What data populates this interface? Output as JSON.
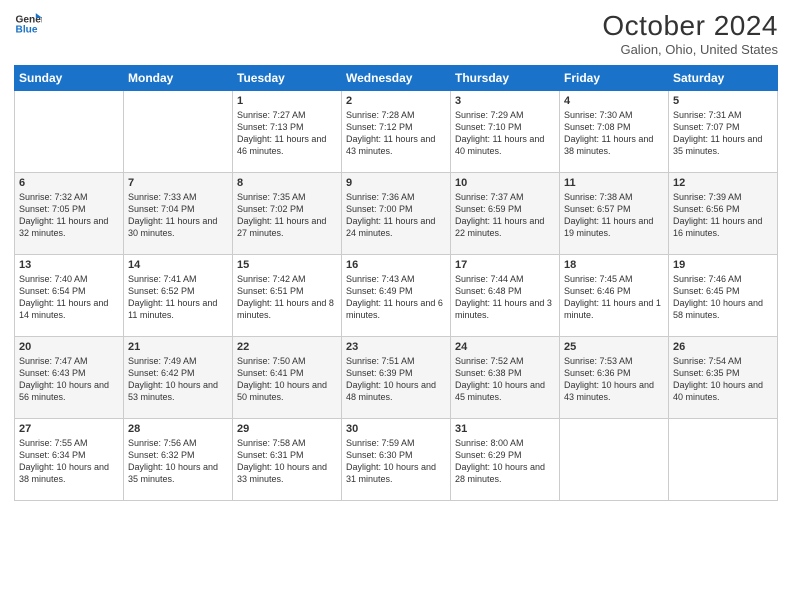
{
  "header": {
    "logo_general": "General",
    "logo_blue": "Blue",
    "month_title": "October 2024",
    "location": "Galion, Ohio, United States"
  },
  "days_of_week": [
    "Sunday",
    "Monday",
    "Tuesday",
    "Wednesday",
    "Thursday",
    "Friday",
    "Saturday"
  ],
  "weeks": [
    [
      {
        "day": "",
        "sunrise": "",
        "sunset": "",
        "daylight": ""
      },
      {
        "day": "",
        "sunrise": "",
        "sunset": "",
        "daylight": ""
      },
      {
        "day": "1",
        "sunrise": "Sunrise: 7:27 AM",
        "sunset": "Sunset: 7:13 PM",
        "daylight": "Daylight: 11 hours and 46 minutes."
      },
      {
        "day": "2",
        "sunrise": "Sunrise: 7:28 AM",
        "sunset": "Sunset: 7:12 PM",
        "daylight": "Daylight: 11 hours and 43 minutes."
      },
      {
        "day": "3",
        "sunrise": "Sunrise: 7:29 AM",
        "sunset": "Sunset: 7:10 PM",
        "daylight": "Daylight: 11 hours and 40 minutes."
      },
      {
        "day": "4",
        "sunrise": "Sunrise: 7:30 AM",
        "sunset": "Sunset: 7:08 PM",
        "daylight": "Daylight: 11 hours and 38 minutes."
      },
      {
        "day": "5",
        "sunrise": "Sunrise: 7:31 AM",
        "sunset": "Sunset: 7:07 PM",
        "daylight": "Daylight: 11 hours and 35 minutes."
      }
    ],
    [
      {
        "day": "6",
        "sunrise": "Sunrise: 7:32 AM",
        "sunset": "Sunset: 7:05 PM",
        "daylight": "Daylight: 11 hours and 32 minutes."
      },
      {
        "day": "7",
        "sunrise": "Sunrise: 7:33 AM",
        "sunset": "Sunset: 7:04 PM",
        "daylight": "Daylight: 11 hours and 30 minutes."
      },
      {
        "day": "8",
        "sunrise": "Sunrise: 7:35 AM",
        "sunset": "Sunset: 7:02 PM",
        "daylight": "Daylight: 11 hours and 27 minutes."
      },
      {
        "day": "9",
        "sunrise": "Sunrise: 7:36 AM",
        "sunset": "Sunset: 7:00 PM",
        "daylight": "Daylight: 11 hours and 24 minutes."
      },
      {
        "day": "10",
        "sunrise": "Sunrise: 7:37 AM",
        "sunset": "Sunset: 6:59 PM",
        "daylight": "Daylight: 11 hours and 22 minutes."
      },
      {
        "day": "11",
        "sunrise": "Sunrise: 7:38 AM",
        "sunset": "Sunset: 6:57 PM",
        "daylight": "Daylight: 11 hours and 19 minutes."
      },
      {
        "day": "12",
        "sunrise": "Sunrise: 7:39 AM",
        "sunset": "Sunset: 6:56 PM",
        "daylight": "Daylight: 11 hours and 16 minutes."
      }
    ],
    [
      {
        "day": "13",
        "sunrise": "Sunrise: 7:40 AM",
        "sunset": "Sunset: 6:54 PM",
        "daylight": "Daylight: 11 hours and 14 minutes."
      },
      {
        "day": "14",
        "sunrise": "Sunrise: 7:41 AM",
        "sunset": "Sunset: 6:52 PM",
        "daylight": "Daylight: 11 hours and 11 minutes."
      },
      {
        "day": "15",
        "sunrise": "Sunrise: 7:42 AM",
        "sunset": "Sunset: 6:51 PM",
        "daylight": "Daylight: 11 hours and 8 minutes."
      },
      {
        "day": "16",
        "sunrise": "Sunrise: 7:43 AM",
        "sunset": "Sunset: 6:49 PM",
        "daylight": "Daylight: 11 hours and 6 minutes."
      },
      {
        "day": "17",
        "sunrise": "Sunrise: 7:44 AM",
        "sunset": "Sunset: 6:48 PM",
        "daylight": "Daylight: 11 hours and 3 minutes."
      },
      {
        "day": "18",
        "sunrise": "Sunrise: 7:45 AM",
        "sunset": "Sunset: 6:46 PM",
        "daylight": "Daylight: 11 hours and 1 minute."
      },
      {
        "day": "19",
        "sunrise": "Sunrise: 7:46 AM",
        "sunset": "Sunset: 6:45 PM",
        "daylight": "Daylight: 10 hours and 58 minutes."
      }
    ],
    [
      {
        "day": "20",
        "sunrise": "Sunrise: 7:47 AM",
        "sunset": "Sunset: 6:43 PM",
        "daylight": "Daylight: 10 hours and 56 minutes."
      },
      {
        "day": "21",
        "sunrise": "Sunrise: 7:49 AM",
        "sunset": "Sunset: 6:42 PM",
        "daylight": "Daylight: 10 hours and 53 minutes."
      },
      {
        "day": "22",
        "sunrise": "Sunrise: 7:50 AM",
        "sunset": "Sunset: 6:41 PM",
        "daylight": "Daylight: 10 hours and 50 minutes."
      },
      {
        "day": "23",
        "sunrise": "Sunrise: 7:51 AM",
        "sunset": "Sunset: 6:39 PM",
        "daylight": "Daylight: 10 hours and 48 minutes."
      },
      {
        "day": "24",
        "sunrise": "Sunrise: 7:52 AM",
        "sunset": "Sunset: 6:38 PM",
        "daylight": "Daylight: 10 hours and 45 minutes."
      },
      {
        "day": "25",
        "sunrise": "Sunrise: 7:53 AM",
        "sunset": "Sunset: 6:36 PM",
        "daylight": "Daylight: 10 hours and 43 minutes."
      },
      {
        "day": "26",
        "sunrise": "Sunrise: 7:54 AM",
        "sunset": "Sunset: 6:35 PM",
        "daylight": "Daylight: 10 hours and 40 minutes."
      }
    ],
    [
      {
        "day": "27",
        "sunrise": "Sunrise: 7:55 AM",
        "sunset": "Sunset: 6:34 PM",
        "daylight": "Daylight: 10 hours and 38 minutes."
      },
      {
        "day": "28",
        "sunrise": "Sunrise: 7:56 AM",
        "sunset": "Sunset: 6:32 PM",
        "daylight": "Daylight: 10 hours and 35 minutes."
      },
      {
        "day": "29",
        "sunrise": "Sunrise: 7:58 AM",
        "sunset": "Sunset: 6:31 PM",
        "daylight": "Daylight: 10 hours and 33 minutes."
      },
      {
        "day": "30",
        "sunrise": "Sunrise: 7:59 AM",
        "sunset": "Sunset: 6:30 PM",
        "daylight": "Daylight: 10 hours and 31 minutes."
      },
      {
        "day": "31",
        "sunrise": "Sunrise: 8:00 AM",
        "sunset": "Sunset: 6:29 PM",
        "daylight": "Daylight: 10 hours and 28 minutes."
      },
      {
        "day": "",
        "sunrise": "",
        "sunset": "",
        "daylight": ""
      },
      {
        "day": "",
        "sunrise": "",
        "sunset": "",
        "daylight": ""
      }
    ]
  ]
}
